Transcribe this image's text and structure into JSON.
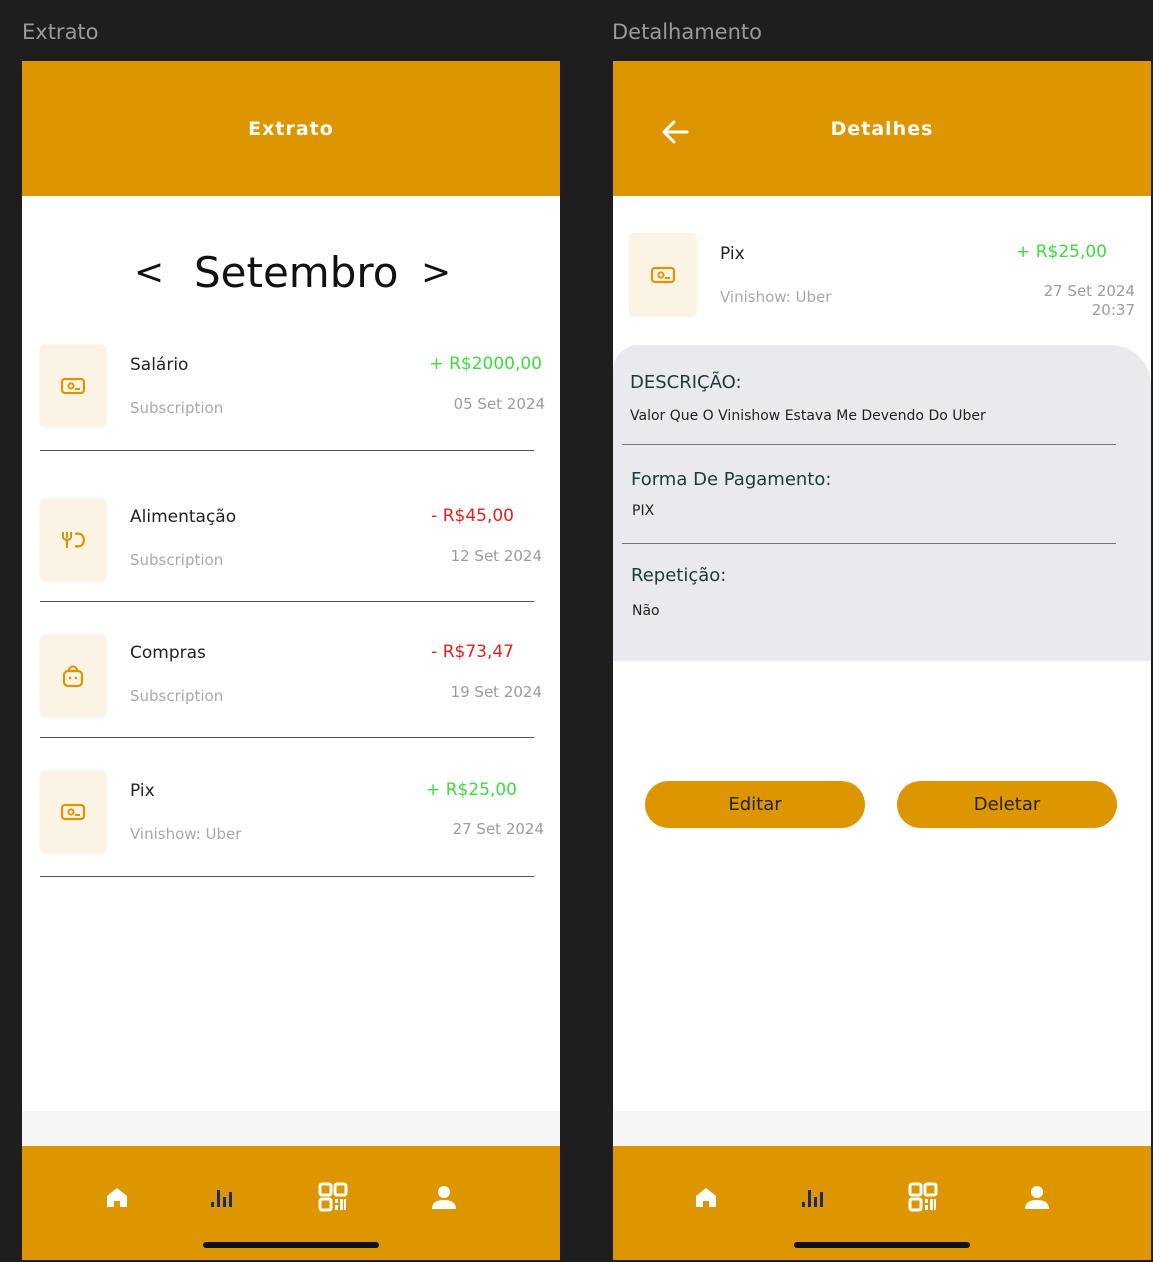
{
  "frames": {
    "left_title": "Extrato",
    "right_title": "Detalhamento"
  },
  "colors": {
    "primary": "#de9600",
    "positive": "#3ddc3d",
    "negative": "#e2211c",
    "icon_bg": "#fbf3e4",
    "panel_bg": "#e9e9ee"
  },
  "extrato": {
    "header_title": "Extrato",
    "month": {
      "prev_symbol": "<",
      "label": "Setembro",
      "next_symbol": ">"
    },
    "transactions": [
      {
        "icon": "money-icon",
        "name": "Salário",
        "subtitle": "Subscription",
        "amount": "+ R$2000,00",
        "type": "positive",
        "date": "05 Set 2024"
      },
      {
        "icon": "food-icon",
        "name": "Alimentação",
        "subtitle": "Subscription",
        "amount": "- R$45,00",
        "type": "negative",
        "date": "12 Set 2024"
      },
      {
        "icon": "shopping-bag-icon",
        "name": "Compras",
        "subtitle": "Subscription",
        "amount": "- R$73,47",
        "type": "negative",
        "date": "19 Set 2024"
      },
      {
        "icon": "money-icon",
        "name": "Pix",
        "subtitle": "Vinishow: Uber",
        "amount": "+ R$25,00",
        "type": "positive",
        "date": "27 Set 2024"
      }
    ]
  },
  "detalhes": {
    "header_title": "Detalhes",
    "transaction": {
      "icon": "money-icon",
      "name": "Pix",
      "subtitle": "Vinishow: Uber",
      "amount": "+ R$25,00",
      "date": "27 Set 2024",
      "time": "20:37"
    },
    "fields": [
      {
        "title": "DESCRIÇÃO:",
        "value": "Valor Que O Vinishow Estava Me Devendo Do Uber"
      },
      {
        "title": "Forma De Pagamento:",
        "value": "PIX"
      },
      {
        "title": "Repetição:",
        "value": "Não"
      }
    ],
    "buttons": {
      "edit": "Editar",
      "delete": "Deletar"
    }
  },
  "nav": {
    "items": [
      "home-icon",
      "chart-icon",
      "qr-code-icon",
      "profile-icon"
    ],
    "active": "chart-icon"
  }
}
